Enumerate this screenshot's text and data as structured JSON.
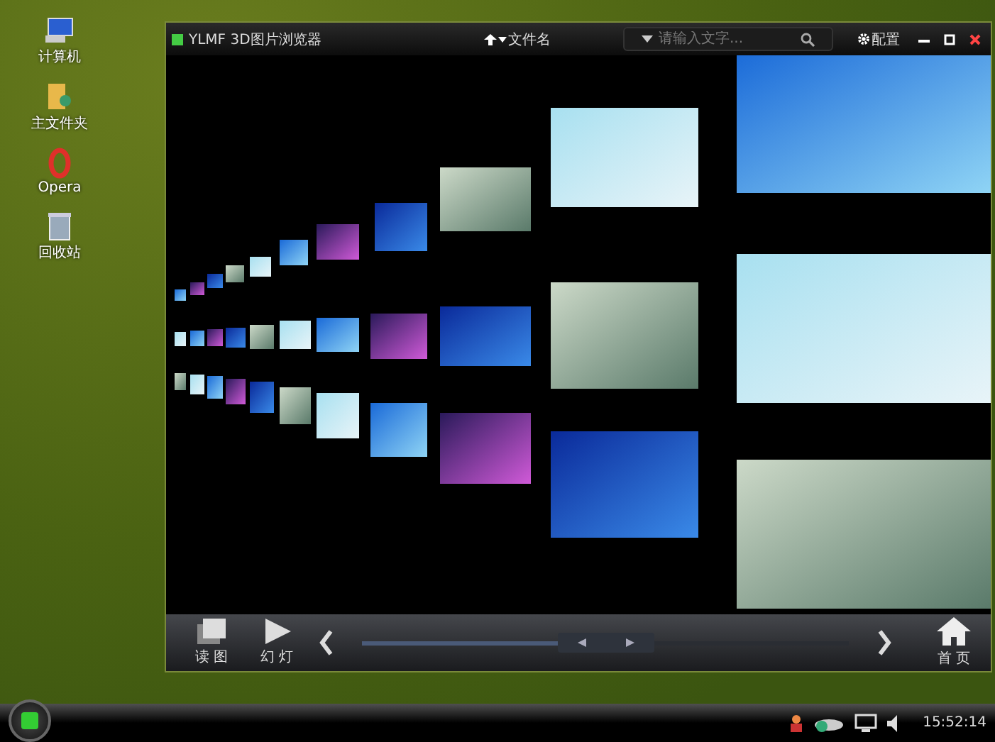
{
  "desktop_icons": [
    {
      "kind": "computer",
      "label": "计算机"
    },
    {
      "kind": "folder",
      "label": "主文件夹"
    },
    {
      "kind": "opera",
      "label": "Opera"
    },
    {
      "kind": "trash",
      "label": "回收站"
    }
  ],
  "window": {
    "title": "YLMF 3D图片浏览器",
    "sort_label": "文件名",
    "search": {
      "placeholder": "请输入文字..."
    },
    "settings_label": "配置"
  },
  "toolbar": {
    "buttons": [
      {
        "kind": "read",
        "label": "读 图"
      },
      {
        "kind": "slideshow",
        "label": "幻 灯"
      }
    ],
    "slider": {
      "level": 0.5
    },
    "home_label": "首 页"
  },
  "taskbar": {
    "clock": "15:52:14"
  }
}
